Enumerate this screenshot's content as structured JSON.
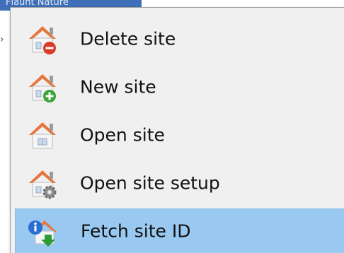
{
  "background_item": {
    "label": "Flaunt Nature"
  },
  "menu": {
    "items": [
      {
        "label": "Delete site",
        "icon": "house-delete-icon",
        "selected": false
      },
      {
        "label": "New site",
        "icon": "house-add-icon",
        "selected": false
      },
      {
        "label": "Open site",
        "icon": "house-icon",
        "selected": false
      },
      {
        "label": "Open site setup",
        "icon": "house-settings-icon",
        "selected": false
      },
      {
        "label": "Fetch site ID",
        "icon": "fetch-id-icon",
        "selected": true
      }
    ]
  },
  "colors": {
    "menu_bg": "#f0f0f0",
    "selection_bg": "#99c9f0",
    "selection_border": "#86b8e3",
    "roof_orange": "#e8743c",
    "delete_red": "#d93b2b",
    "add_green": "#3aa33a",
    "info_blue": "#2a6fd1",
    "download_green": "#2e9b37"
  }
}
